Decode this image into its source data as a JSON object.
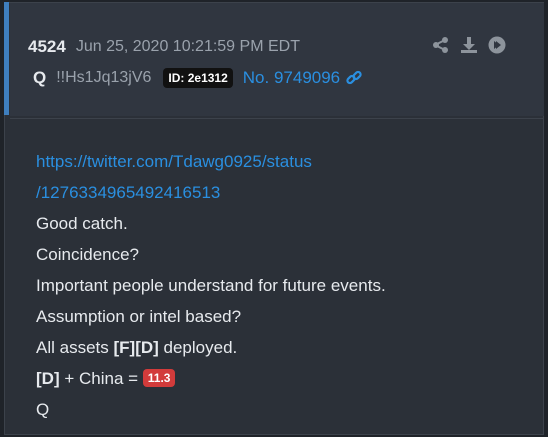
{
  "post": {
    "number": "4524",
    "date": "Jun 25, 2020 10:21:59 PM EDT",
    "author": "Q",
    "tripcode": "!!Hs1Jq13jV6",
    "id_badge": "ID: 2e1312",
    "post_ref": "No. 9749096"
  },
  "icons": [
    "share-icon",
    "download-icon",
    "arrow-right-circle-icon",
    "link-icon"
  ],
  "body": {
    "url_line1": "https://twitter.com/Tdawg0925/status",
    "url_line2": "/1276334965492416513",
    "line3": "Good catch.",
    "line4": "Coincidence?",
    "line5": "Important people understand for future events.",
    "line6": "Assumption or intel based?",
    "line7_pre": "All assets ",
    "line7_bold": "[F][D]",
    "line7_post": " deployed.",
    "line8_bold": "[D]",
    "line8_mid": " + China = ",
    "line8_badge": "11.3",
    "line9": "Q"
  },
  "colors": {
    "background": "#2b3038",
    "header": "#303640",
    "accent": "#3f7fbf",
    "link": "#2a8fe0",
    "badge_red": "#d23b3b"
  }
}
